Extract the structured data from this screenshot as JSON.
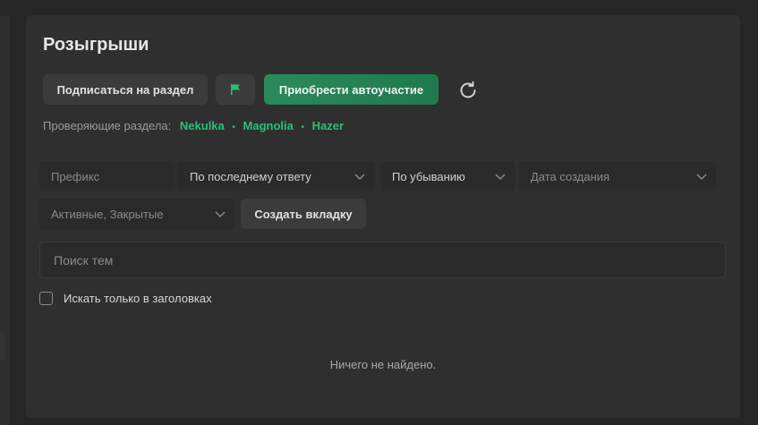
{
  "page": {
    "title": "Розыгрыши"
  },
  "toolbar": {
    "subscribe_label": "Подписаться на раздел",
    "autoparticipate_label": "Приобрести автоучастие",
    "flag_icon": "flag-icon",
    "refresh_icon": "refresh-icon",
    "accent_color": "#2bbf7a"
  },
  "reviewers": {
    "label": "Проверяющие раздела:",
    "names": [
      "Nekulka",
      "Magnolia",
      "Hazer"
    ],
    "separator": "•"
  },
  "filters": {
    "prefix_placeholder": "Префикс",
    "sort_value": "По последнему ответу",
    "order_value": "По убыванию",
    "date_placeholder": "Дата создания",
    "state_value": "Активные, Закрытые",
    "create_tab_label": "Создать вкладку"
  },
  "search": {
    "placeholder": "Поиск тем",
    "titles_only_label": "Искать только в заголовках"
  },
  "results": {
    "empty_text": "Ничего не найдено."
  }
}
